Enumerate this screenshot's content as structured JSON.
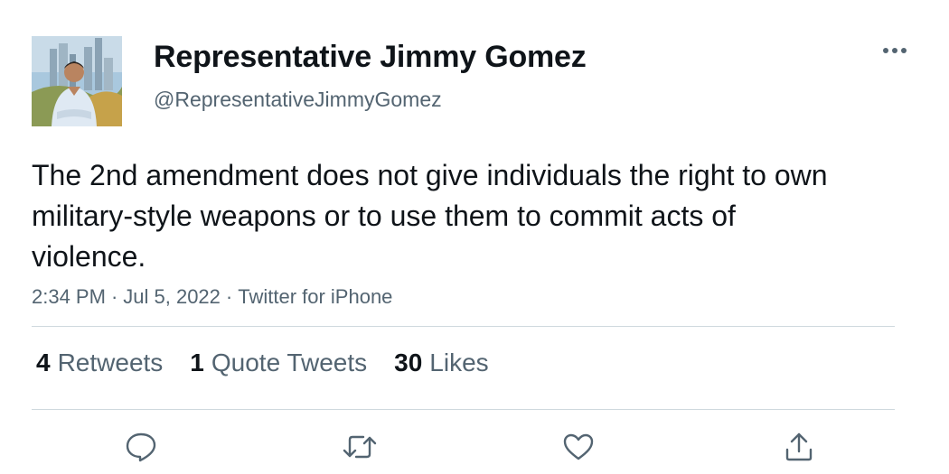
{
  "author": {
    "display_name": "Representative Jimmy Gomez",
    "handle": "@RepresentativeJimmyGomez",
    "avatar_icon": "profile-photo"
  },
  "more_icon": "more-dots-icon",
  "body": "The 2nd amendment does not give individuals the right to own military-style weapons or to use them to commit acts of violence.",
  "meta": {
    "time": "2:34 PM",
    "separator": "·",
    "date": "Jul 5, 2022",
    "source": "Twitter for iPhone"
  },
  "stats": [
    {
      "count": "4",
      "label": "Retweets"
    },
    {
      "count": "1",
      "label": "Quote Tweets"
    },
    {
      "count": "30",
      "label": "Likes"
    }
  ],
  "actions": [
    {
      "name": "reply",
      "icon": "reply-bubble-icon"
    },
    {
      "name": "retweet",
      "icon": "retweet-icon"
    },
    {
      "name": "like",
      "icon": "heart-icon"
    },
    {
      "name": "share",
      "icon": "share-icon"
    }
  ],
  "colors": {
    "text_primary": "#0f1419",
    "text_secondary": "#536471",
    "divider": "#cfd9de",
    "icon": "#536471"
  }
}
